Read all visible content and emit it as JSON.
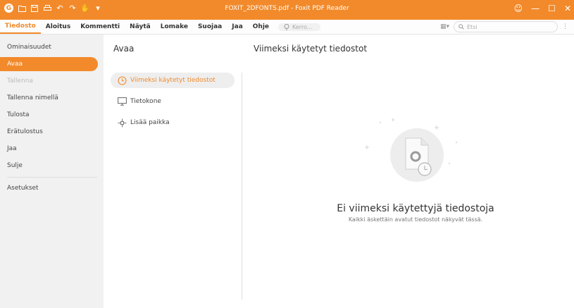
{
  "window": {
    "title": "FOXIT_2DFONTS.pdf - Foxit PDF Reader"
  },
  "quick_access": [
    "foxit-logo-icon",
    "open-icon",
    "save-icon",
    "print-icon",
    "undo-icon",
    "redo-icon",
    "hand-icon",
    "customize-icon"
  ],
  "menubar": {
    "items": [
      "Tiedosto",
      "Aloitus",
      "Kommentti",
      "Näytä",
      "Lomake",
      "Suojaa",
      "Jaa",
      "Ohje"
    ],
    "active": "Tiedosto",
    "tell_me_placeholder": "Kerro...",
    "search_placeholder": "Etsi"
  },
  "leftnav": {
    "items": [
      {
        "label": "Ominaisuudet",
        "state": "normal"
      },
      {
        "label": "Avaa",
        "state": "active"
      },
      {
        "label": "Tallenna",
        "state": "disabled"
      },
      {
        "label": "Tallenna nimellä",
        "state": "normal"
      },
      {
        "label": "Tulosta",
        "state": "normal"
      },
      {
        "label": "Erätulostus",
        "state": "normal"
      },
      {
        "label": "Jaa",
        "state": "normal"
      },
      {
        "label": "Sulje",
        "state": "normal"
      },
      {
        "label": "Asetukset",
        "state": "normal"
      }
    ]
  },
  "open_pane": {
    "title": "Avaa",
    "locations": [
      {
        "label": "Viimeksi käytetyt tiedostot",
        "icon": "clock-icon",
        "active": true
      },
      {
        "label": "Tietokone",
        "icon": "monitor-icon",
        "active": false
      },
      {
        "label": "Lisää paikka",
        "icon": "add-place-icon",
        "active": false
      }
    ]
  },
  "recent": {
    "title": "Viimeksi käytetyt tiedostot",
    "empty_title": "Ei viimeksi käytettyjä tiedostoja",
    "empty_subtitle": "Kaikki äskettäin avatut tiedostot näkyvät tässä."
  },
  "colors": {
    "accent": "#f28a2b",
    "nav_bg": "#f1f1f1"
  }
}
